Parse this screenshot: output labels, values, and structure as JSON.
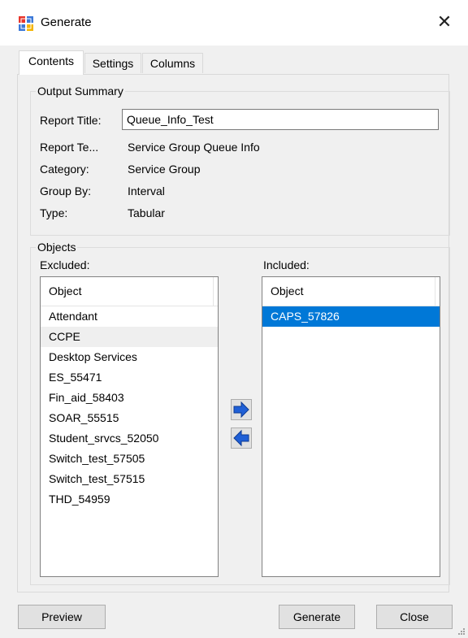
{
  "window": {
    "title": "Generate",
    "app_icon": "report-app-icon",
    "close_symbol": "✕"
  },
  "tabs": [
    {
      "label": "Contents",
      "active": true
    },
    {
      "label": "Settings",
      "active": false
    },
    {
      "label": "Columns",
      "active": false
    }
  ],
  "output_summary": {
    "legend": "Output Summary",
    "report_title_label": "Report Title:",
    "report_title_value": "Queue_Info_Test",
    "rows": [
      {
        "label": "Report Te...",
        "value": "Service Group Queue Info"
      },
      {
        "label": "Category:",
        "value": "Service Group"
      },
      {
        "label": "Group By:",
        "value": "Interval"
      },
      {
        "label": "Type:",
        "value": "Tabular"
      }
    ]
  },
  "objects": {
    "legend": "Objects",
    "excluded_label": "Excluded:",
    "included_label": "Included:",
    "excluded_header": "Object",
    "included_header": "Object",
    "excluded_items": [
      "Attendant",
      "CCPE",
      "Desktop Services",
      "ES_55471",
      "Fin_aid_58403",
      "SOAR_55515",
      "Student_srvcs_52050",
      "Switch_test_57505",
      "Switch_test_57515",
      "THD_54959"
    ],
    "included_items": [
      "CAPS_57826"
    ],
    "hovered_excluded": "CCPE",
    "selected_included": "CAPS_57826",
    "move_right_icon": "arrow-right-icon",
    "move_left_icon": "arrow-left-icon"
  },
  "buttons": {
    "preview": "Preview",
    "generate": "Generate",
    "close": "Close"
  },
  "colors": {
    "selection": "#0078d7",
    "arrow_blue": "#1f5fd6",
    "window_bg": "#f0f0f0"
  }
}
